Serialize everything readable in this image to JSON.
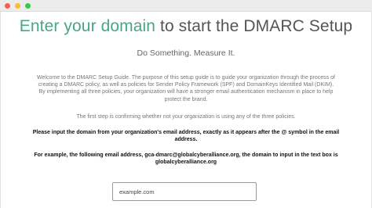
{
  "window": {
    "controls": [
      "close",
      "minimize",
      "maximize"
    ],
    "control_colors": {
      "close": "#f25f58",
      "minimize": "#f9bd2e",
      "maximize": "#3bc74b"
    }
  },
  "header": {
    "title_accent": "Enter your domain",
    "title_rest": " to start the DMARC Setup",
    "subtitle": "Do Something. Measure It."
  },
  "body": {
    "intro": "Welcome to the DMARC Setup Guide. The purpose of this setup guide is to guide your organization through the process of creating a DMARC policy, as well as policies for Sender Policy Framework (SPF) and DomainKeys Identified Mail (DKIM). By implementing all three policies, your organization will have a stronger email authentication mechanism in place to help protect the brand.",
    "first_step": "The first step is confirming whether not your organization is using any of the three policies.",
    "instruction": "Please input the domain from your organization's email address, exactly as it appears after the @ symbol in the email address.",
    "example": "For example, the following email address, gca-dmarc@globalcyberalliance.org, the domain to input in the text box is globalcyberalliance.org"
  },
  "form": {
    "domain_placeholder": "example.com",
    "domain_value": ""
  },
  "colors": {
    "accent": "#48a58c",
    "heading": "#555555",
    "body_text": "#777777",
    "emphasis_text": "#111111"
  }
}
